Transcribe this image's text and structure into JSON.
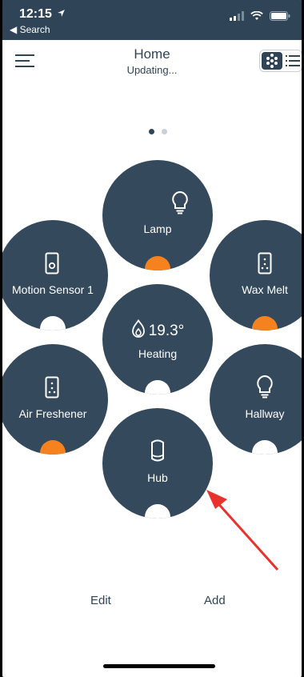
{
  "status_bar": {
    "time": "12:15",
    "back_link": "◀ Search"
  },
  "header": {
    "title": "Home",
    "subtitle": "Updating..."
  },
  "devices": {
    "lamp": {
      "label": "Lamp",
      "icon": "bulb-icon",
      "state": "on"
    },
    "motion_sensor": {
      "label": "Motion Sensor 1",
      "icon": "sensor-icon",
      "state": "off"
    },
    "wax_melt": {
      "label": "Wax Melt",
      "icon": "plug-icon",
      "state": "on"
    },
    "heating": {
      "label": "Heating",
      "temperature": "19.3°",
      "icon": "flame-icon",
      "state": "off"
    },
    "air_freshener": {
      "label": "Air Freshener",
      "icon": "plug-icon",
      "state": "on"
    },
    "hallway": {
      "label": "Hallway",
      "icon": "bulb-icon",
      "state": "off"
    },
    "hub": {
      "label": "Hub",
      "icon": "hub-icon",
      "state": "off"
    }
  },
  "footer": {
    "edit_label": "Edit",
    "add_label": "Add"
  },
  "colors": {
    "tile": "#34495c",
    "header": "#2f4456",
    "accent_on": "#f5821f",
    "annotation_arrow": "#e8322e"
  }
}
